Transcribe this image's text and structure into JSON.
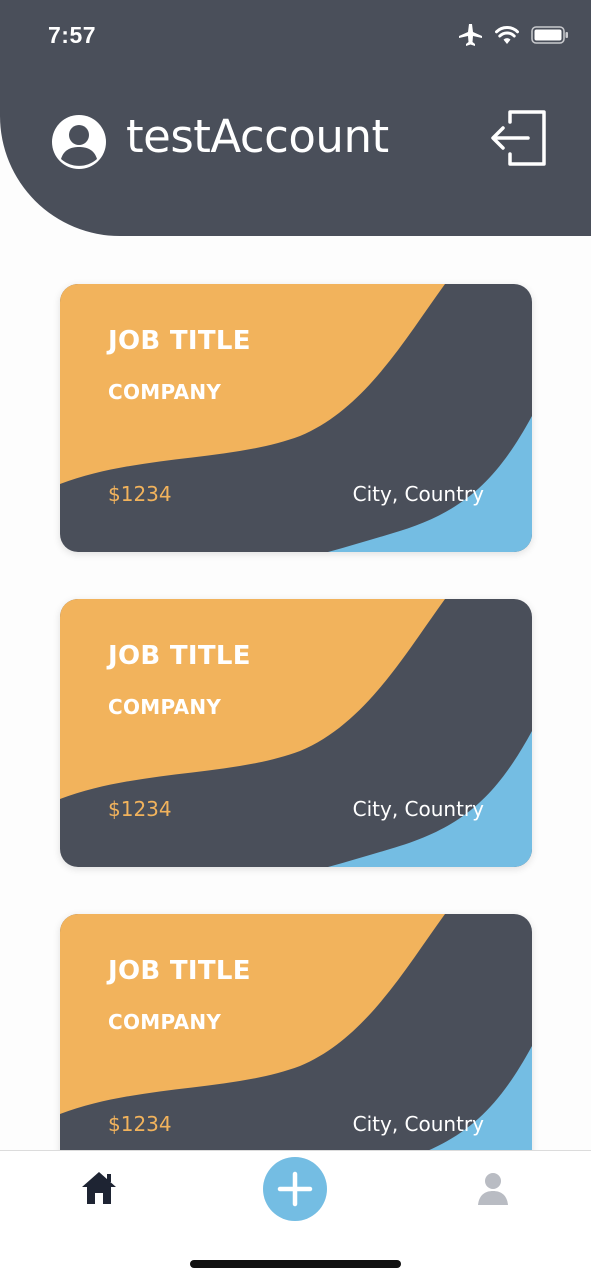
{
  "status_bar": {
    "time": "7:57"
  },
  "header": {
    "account_name": "testAccount",
    "avatar_icon": "user-circle-icon",
    "logout_icon": "logout-icon"
  },
  "colors": {
    "header_bg": "#4a4f5a",
    "card_orange": "#f2b35c",
    "card_dark": "#4a4f5a",
    "card_blue": "#74bde3"
  },
  "jobs": [
    {
      "title": "JOB TITLE",
      "company": "COMPANY",
      "salary": "$1234",
      "location": "City, Country"
    },
    {
      "title": "JOB TITLE",
      "company": "COMPANY",
      "salary": "$1234",
      "location": "City, Country"
    },
    {
      "title": "JOB TITLE",
      "company": "COMPANY",
      "salary": "$1234",
      "location": "City, Country"
    }
  ],
  "tab_bar": {
    "home_icon": "home-icon",
    "add_icon": "plus-icon",
    "profile_icon": "user-icon"
  }
}
